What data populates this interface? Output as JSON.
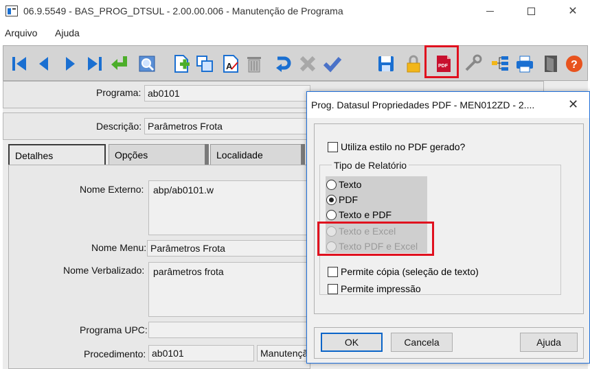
{
  "window": {
    "title": "06.9.5549 - BAS_PROG_DTSUL - 2.00.00.006 - Manutenção de Programa"
  },
  "menu": {
    "items": [
      "Arquivo",
      "Ajuda"
    ]
  },
  "toolbar": {
    "icons": [
      "first-icon",
      "prev-icon",
      "next-icon",
      "last-icon",
      "goto-icon",
      "search-icon",
      "new-icon",
      "copy-icon",
      "edit-icon",
      "delete-icon",
      "undo-icon",
      "cancel-icon",
      "confirm-icon",
      "save-icon",
      "lock-icon",
      "pdf-icon",
      "tools-icon",
      "tree-icon",
      "print-icon",
      "exit-icon",
      "help-icon"
    ],
    "pdf_label": "PDF"
  },
  "form": {
    "programa_label": "Programa:",
    "programa_value": "ab0101",
    "descricao_label": "Descrição:",
    "descricao_value": "Parâmetros Frota",
    "tabs": [
      "Detalhes",
      "Opções",
      "Localidade"
    ],
    "nome_externo_label": "Nome Externo:",
    "nome_externo_value": "abp/ab0101.w",
    "nome_menu_label": "Nome Menu:",
    "nome_menu_value": "Parâmetros Frota",
    "nome_verbalizado_label": "Nome Verbalizado:",
    "nome_verbalizado_value": "parâmetros frota",
    "programa_upc_label": "Programa UPC:",
    "programa_upc_value": "",
    "procedimento_label": "Procedimento:",
    "procedimento_value": "ab0101",
    "procedimento_desc": "Manutençã"
  },
  "dialog": {
    "title": "Prog. Datasul Propriedades PDF - MEN012ZD - 2....",
    "utiliza_estilo": "Utiliza estilo no PDF gerado?",
    "tipo_relatorio": "Tipo de Relatório",
    "options": [
      {
        "label": "Texto",
        "checked": false,
        "disabled": false
      },
      {
        "label": "PDF",
        "checked": true,
        "disabled": false
      },
      {
        "label": "Texto e PDF",
        "checked": false,
        "disabled": false
      },
      {
        "label": "Texto e Excel",
        "checked": false,
        "disabled": true
      },
      {
        "label": "Texto PDF e Excel",
        "checked": false,
        "disabled": true
      }
    ],
    "permite_copia": "Permite cópia (seleção de texto)",
    "permite_impressao": "Permite impressão",
    "ok": "OK",
    "cancela": "Cancela",
    "ajuda": "Ajuda"
  },
  "colors": {
    "highlight": "#e0101e",
    "toolbar_blue": "#1a6fd1",
    "dialog_border": "#1f6fd9"
  }
}
